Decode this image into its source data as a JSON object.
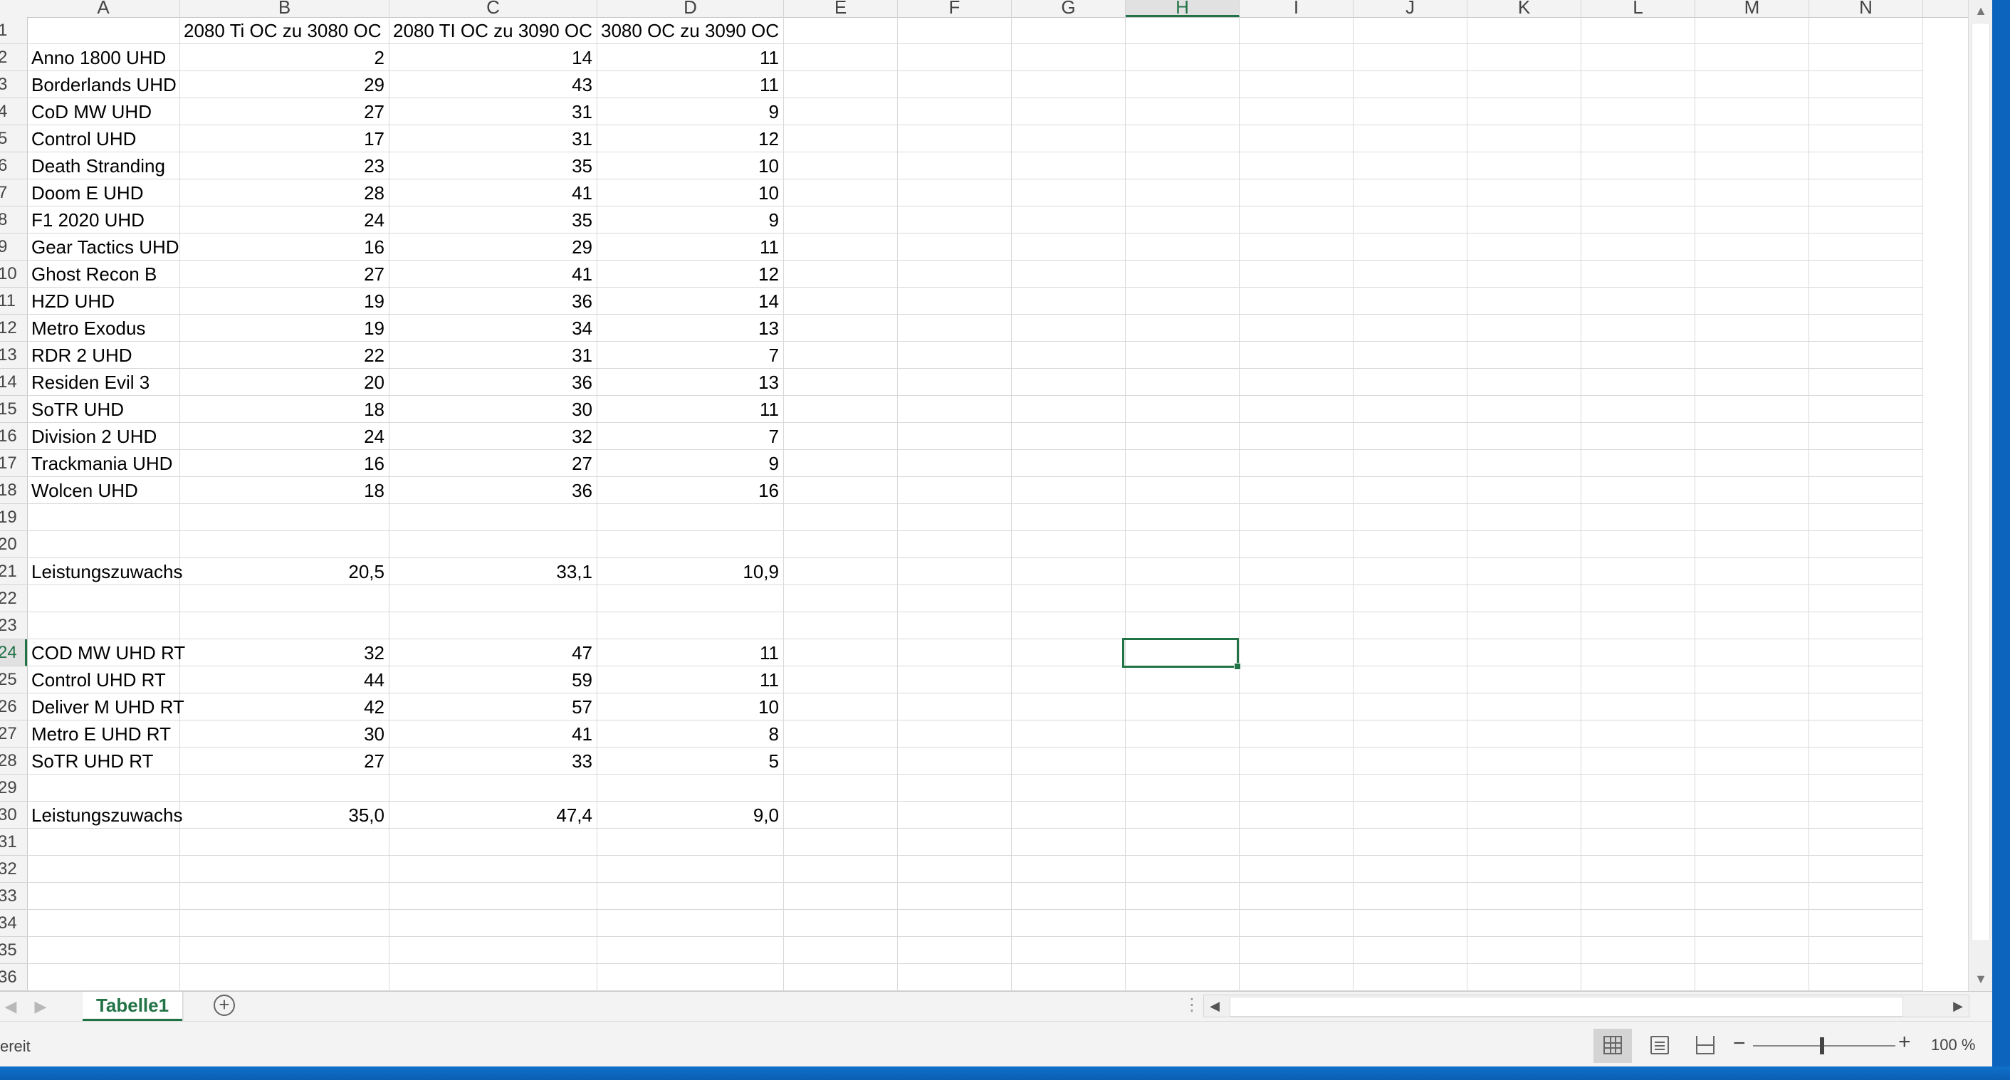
{
  "column_headers": [
    "A",
    "B",
    "C",
    "D",
    "E",
    "F",
    "G",
    "H",
    "I",
    "J",
    "K",
    "L",
    "M",
    "N"
  ],
  "selected_column": "H",
  "row_numbers": [
    "1",
    "2",
    "3",
    "4",
    "5",
    "6",
    "7",
    "8",
    "9",
    "10",
    "11",
    "12",
    "13",
    "14",
    "15",
    "16",
    "17",
    "18",
    "19",
    "20",
    "21",
    "22",
    "23",
    "24",
    "25",
    "26",
    "27",
    "28",
    "29",
    "30",
    "31",
    "32",
    "33",
    "34",
    "35",
    "36"
  ],
  "selected_row": "24",
  "header_row": {
    "B": "2080 Ti  OC zu 3080 OC",
    "C": "2080 TI  OC zu 3090 OC",
    "D": "3080 OC zu 3090 OC"
  },
  "rows": [
    {
      "row": "2",
      "a": "Anno 1800 UHD",
      "b": "2",
      "c": "14",
      "d": "11"
    },
    {
      "row": "3",
      "a": "Borderlands UHD",
      "b": "29",
      "c": "43",
      "d": "11"
    },
    {
      "row": "4",
      "a": "CoD MW UHD",
      "b": "27",
      "c": "31",
      "d": "9"
    },
    {
      "row": "5",
      "a": "Control UHD",
      "b": "17",
      "c": "31",
      "d": "12"
    },
    {
      "row": "6",
      "a": "Death Stranding",
      "b": "23",
      "c": "35",
      "d": "10"
    },
    {
      "row": "7",
      "a": "Doom E UHD",
      "b": "28",
      "c": "41",
      "d": "10"
    },
    {
      "row": "8",
      "a": "F1 2020 UHD",
      "b": "24",
      "c": "35",
      "d": "9"
    },
    {
      "row": "9",
      "a": "Gear Tactics UHD",
      "b": "16",
      "c": "29",
      "d": "11"
    },
    {
      "row": "10",
      "a": "Ghost Recon B",
      "b": "27",
      "c": "41",
      "d": "12"
    },
    {
      "row": "11",
      "a": "HZD UHD",
      "b": "19",
      "c": "36",
      "d": "14"
    },
    {
      "row": "12",
      "a": "Metro Exodus",
      "b": "19",
      "c": "34",
      "d": "13"
    },
    {
      "row": "13",
      "a": "RDR 2 UHD",
      "b": "22",
      "c": "31",
      "d": "7"
    },
    {
      "row": "14",
      "a": "Residen Evil 3",
      "b": "20",
      "c": "36",
      "d": "13"
    },
    {
      "row": "15",
      "a": "SoTR UHD",
      "b": "18",
      "c": "30",
      "d": "11"
    },
    {
      "row": "16",
      "a": "Division 2 UHD",
      "b": "24",
      "c": "32",
      "d": "7"
    },
    {
      "row": "17",
      "a": "Trackmania UHD",
      "b": "16",
      "c": "27",
      "d": "9"
    },
    {
      "row": "18",
      "a": "Wolcen UHD",
      "b": "18",
      "c": "36",
      "d": "16"
    },
    {
      "row": "19",
      "a": "",
      "b": "",
      "c": "",
      "d": ""
    },
    {
      "row": "20",
      "a": "",
      "b": "",
      "c": "",
      "d": ""
    },
    {
      "row": "21",
      "a": "Leistungszuwachs",
      "b": "20,5",
      "c": "33,1",
      "d": "10,9"
    },
    {
      "row": "22",
      "a": "",
      "b": "",
      "c": "",
      "d": ""
    },
    {
      "row": "23",
      "a": "",
      "b": "",
      "c": "",
      "d": ""
    },
    {
      "row": "24",
      "a": "COD MW UHD RT",
      "b": "32",
      "c": "47",
      "d": "11"
    },
    {
      "row": "25",
      "a": "Control UHD RT",
      "b": "44",
      "c": "59",
      "d": "11"
    },
    {
      "row": "26",
      "a": "Deliver M UHD RT",
      "b": "42",
      "c": "57",
      "d": "10"
    },
    {
      "row": "27",
      "a": "Metro E UHD RT",
      "b": "30",
      "c": "41",
      "d": "8"
    },
    {
      "row": "28",
      "a": "SoTR UHD RT",
      "b": "27",
      "c": "33",
      "d": "5"
    },
    {
      "row": "29",
      "a": "",
      "b": "",
      "c": "",
      "d": ""
    },
    {
      "row": "30",
      "a": "Leistungszuwachs",
      "b": "35,0",
      "c": "47,4",
      "d": "9,0"
    },
    {
      "row": "31",
      "a": "",
      "b": "",
      "c": "",
      "d": ""
    },
    {
      "row": "32",
      "a": "",
      "b": "",
      "c": "",
      "d": ""
    },
    {
      "row": "33",
      "a": "",
      "b": "",
      "c": "",
      "d": ""
    },
    {
      "row": "34",
      "a": "",
      "b": "",
      "c": "",
      "d": ""
    },
    {
      "row": "35",
      "a": "",
      "b": "",
      "c": "",
      "d": ""
    },
    {
      "row": "36",
      "a": "",
      "b": "",
      "c": "",
      "d": ""
    }
  ],
  "sheet_tab": "Tabelle1",
  "status_text": "ereit",
  "zoom_level": "100 %",
  "icons": {
    "add_sheet": "plus-circle-icon",
    "normal_view": "grid-icon",
    "page_layout": "page-layout-icon",
    "page_break": "page-break-icon"
  },
  "colors": {
    "accent": "#217346",
    "taskbar": "#0c64bd"
  }
}
